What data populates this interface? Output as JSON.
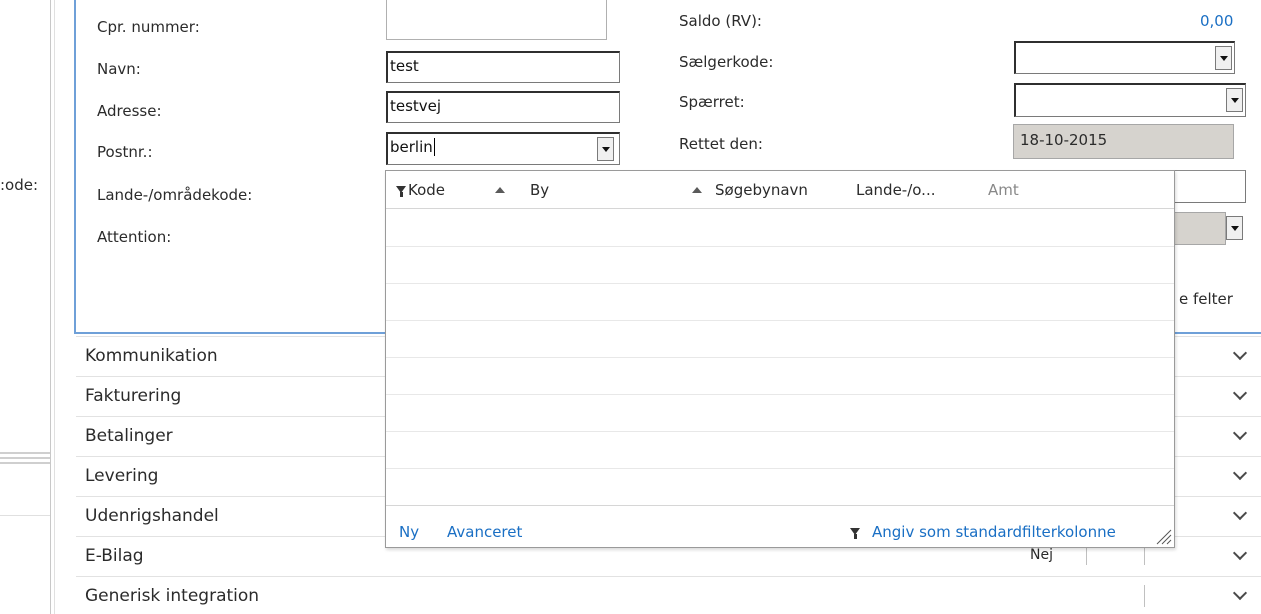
{
  "left_cut_label": ":ode:",
  "form": {
    "left": [
      {
        "label": "Cpr. nummer:",
        "value": ""
      },
      {
        "label": "Navn:",
        "value": "test"
      },
      {
        "label": "Adresse:",
        "value": "testvej"
      },
      {
        "label": "Postnr.:",
        "value": "berlin"
      },
      {
        "label": "Lande-/områdekode:"
      },
      {
        "label": "Attention:"
      }
    ],
    "right": {
      "saldo_label": "Saldo (RV):",
      "saldo_value": "0,00",
      "saelgerkode_label": "Sælgerkode:",
      "spaerret_label": "Spærret:",
      "rettet_label": "Rettet den:",
      "rettet_value": "18-10-2015",
      "felter_text": "e felter"
    }
  },
  "lookup": {
    "columns": [
      "Kode",
      "By",
      "Søgebynavn",
      "Lande-/o...",
      "Amt"
    ],
    "footer": {
      "new": "Ny",
      "advanced": "Avanceret",
      "default_filter": "Angiv som standardfilterkolonne"
    }
  },
  "sections": [
    "Kommunikation",
    "Fakturering",
    "Betalinger",
    "Levering",
    "Udenrigshandel",
    "E-Bilag",
    "Generisk integration"
  ],
  "ebilag_value": "Nej",
  "colors": {
    "accent": "#6fa0d8",
    "link": "#1a6fc4",
    "readonly": "#d6d3ce"
  }
}
